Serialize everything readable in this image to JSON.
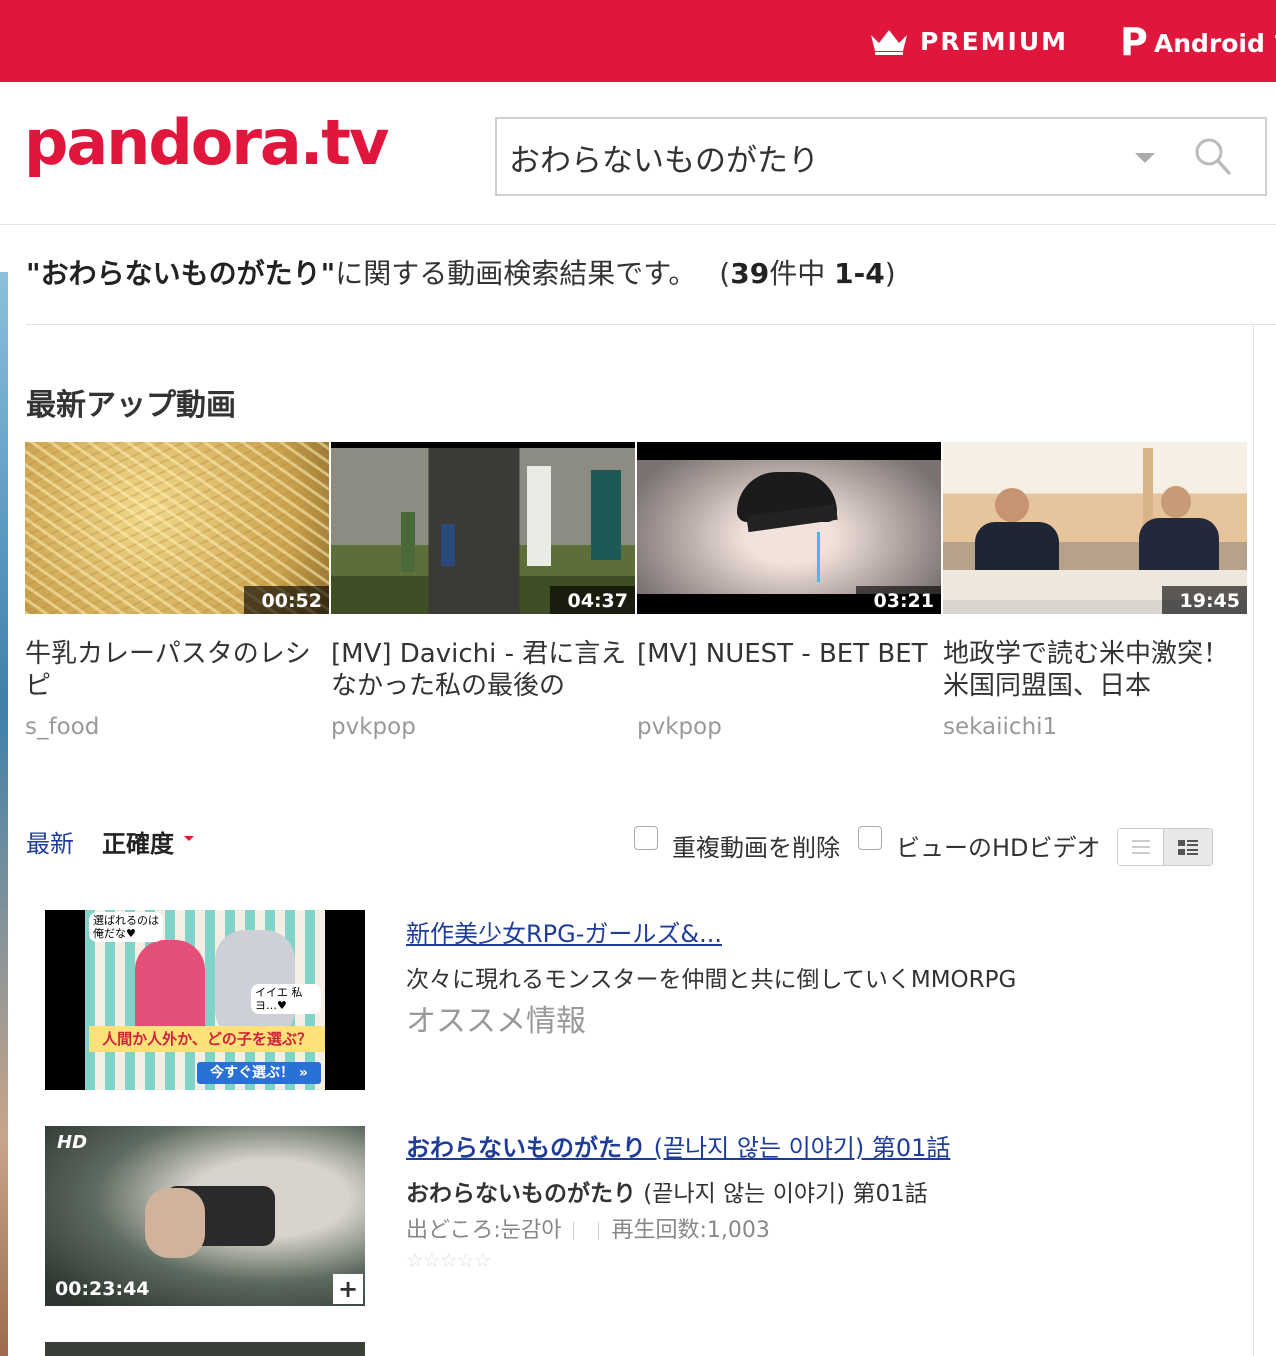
{
  "topbar": {
    "premium_label": "PREMIUM",
    "android_label": "Android で",
    "android_icon_letter": "P"
  },
  "header": {
    "logo_text": "pandora.tv",
    "search_value": "おわらないものがたり"
  },
  "results": {
    "query_quoted": "\"おわらないものがたり\"",
    "suffix": "に関する動画検索結果です。",
    "open_paren": "(",
    "total": "39",
    "total_unit": "件中",
    "range": "1-4",
    "close_paren": ")"
  },
  "latest": {
    "section_title": "最新アップ動画",
    "items": [
      {
        "title": "牛乳カレーパスタのレシピ",
        "channel": "s_food",
        "duration": "00:52"
      },
      {
        "title": "[MV] Davichi - 君に言えなかった私の最後の",
        "channel": "pvkpop",
        "duration": "04:37"
      },
      {
        "title": "[MV] NUEST - BET BET",
        "channel": "pvkpop",
        "duration": "03:21"
      },
      {
        "title": "地政学で読む米中激突！米国同盟国、日本",
        "channel": "sekaiichi1",
        "duration": "19:45"
      }
    ]
  },
  "sortbar": {
    "latest_label": "最新",
    "accuracy_label": "正確度",
    "dedupe_label": "重複動画を削除",
    "hd_label": "ビューのHDビデオ"
  },
  "list": {
    "ad": {
      "title": "新作美少女RPG-ガールズ&...",
      "desc": "次々に現れるモンスターを仲間と共に倒していくMMORPG",
      "info": "オススメ情報",
      "thumb_top_text": "選ばれるのは俺だな♥",
      "thumb_side_text": "イイエ 私ヨ…♥",
      "thumb_banner": "人間か人外か、どの子を選ぶ？",
      "thumb_button": "今すぐ選ぶ！ »"
    },
    "video": {
      "title_bold": "おわらないものがたり",
      "title_rest": " (끝나지 않는 이야기) 第01話",
      "desc_bold": "おわらないものがたり",
      "desc_rest": " (끝나지 않는 이야기) 第01話",
      "source": "出どころ:눈감아",
      "views": "再生回数:1,003",
      "duration": "00:23:44",
      "hd_badge": "HD",
      "plus": "+",
      "stars": "☆☆☆☆☆"
    }
  }
}
